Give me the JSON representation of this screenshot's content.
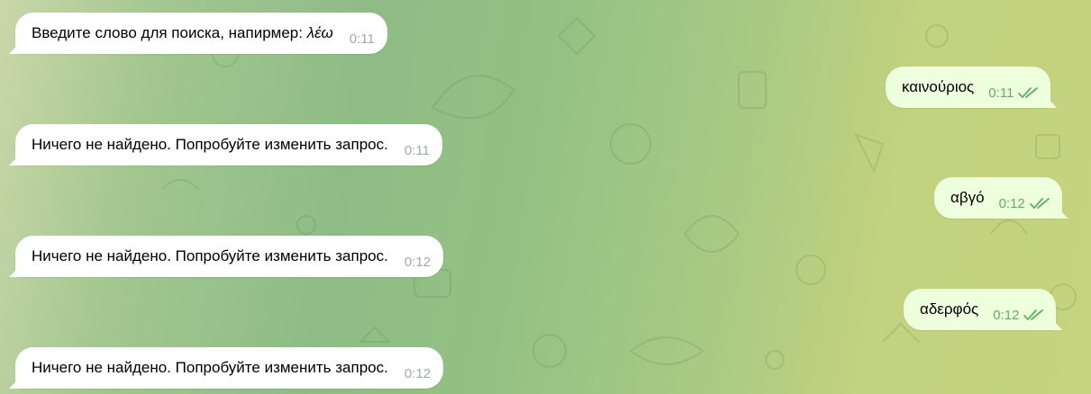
{
  "colors": {
    "incoming_bubble": "#ffffff",
    "outgoing_bubble": "#eeffde",
    "incoming_time": "#a3a8ad",
    "outgoing_time": "#5fb060",
    "read_ticks": "#5fb060"
  },
  "messages": [
    {
      "direction": "incoming",
      "text": "Введите слово для поиска, напирмер: ",
      "example": "λέω",
      "time": "0:11"
    },
    {
      "direction": "outgoing",
      "text": "καινούριος",
      "time": "0:11",
      "status_icon": "double-check-icon"
    },
    {
      "direction": "incoming",
      "text": "Ничего не найдено. Попробуйте изменить запрос.",
      "time": "0:11"
    },
    {
      "direction": "outgoing",
      "text": "αβγό",
      "time": "0:12",
      "status_icon": "double-check-icon"
    },
    {
      "direction": "incoming",
      "text": "Ничего не найдено. Попробуйте изменить запрос.",
      "time": "0:12"
    },
    {
      "direction": "outgoing",
      "text": "αδερφός",
      "time": "0:12",
      "status_icon": "double-check-icon"
    },
    {
      "direction": "incoming",
      "text": "Ничего не найдено. Попробуйте изменить запрос.",
      "time": "0:12"
    }
  ]
}
